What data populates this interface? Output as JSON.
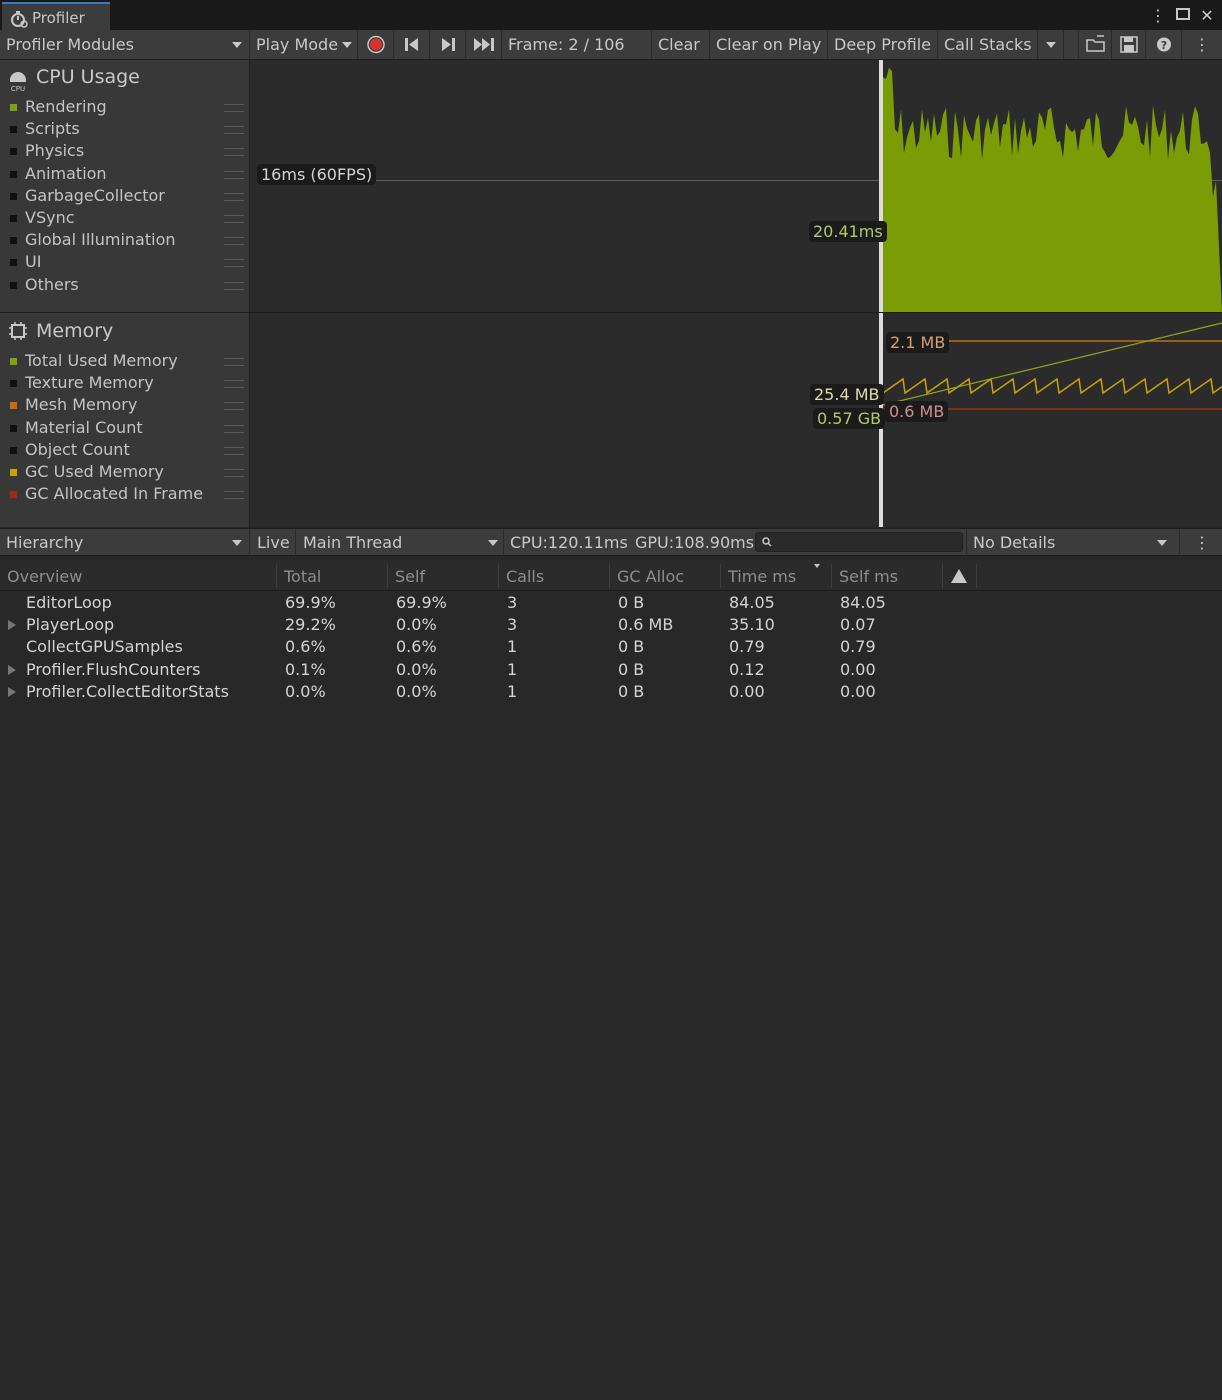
{
  "window": {
    "tab_title": "Profiler"
  },
  "toolbar": {
    "modules_label": "Profiler Modules",
    "play_mode_label": "Play Mode",
    "frame_label": "Frame: 2 / 106",
    "clear_label": "Clear",
    "clear_on_play_label": "Clear on Play",
    "deep_profile_label": "Deep Profile",
    "call_stacks_label": "Call Stacks",
    "record_color": "#d9342b"
  },
  "cpu_module": {
    "title": "CPU Usage",
    "icon_text": "CPU",
    "items": [
      {
        "label": "Rendering",
        "color": "#7ca113"
      },
      {
        "label": "Scripts",
        "color": "#111111"
      },
      {
        "label": "Physics",
        "color": "#111111"
      },
      {
        "label": "Animation",
        "color": "#111111"
      },
      {
        "label": "GarbageCollector",
        "color": "#111111"
      },
      {
        "label": "VSync",
        "color": "#111111"
      },
      {
        "label": "Global Illumination",
        "color": "#111111"
      },
      {
        "label": "UI",
        "color": "#111111"
      },
      {
        "label": "Others",
        "color": "#111111"
      }
    ],
    "fps_marker": "16ms (60FPS)",
    "selected_value": "20.41ms",
    "fill_color": "#7b9c04"
  },
  "memory_module": {
    "title": "Memory",
    "items": [
      {
        "label": "Total Used Memory",
        "color": "#7ca113"
      },
      {
        "label": "Texture Memory",
        "color": "#111111"
      },
      {
        "label": "Mesh Memory",
        "color": "#c86a14"
      },
      {
        "label": "Material Count",
        "color": "#111111"
      },
      {
        "label": "Object Count",
        "color": "#111111"
      },
      {
        "label": "GC Used Memory",
        "color": "#c9a20a"
      },
      {
        "label": "GC Allocated In Frame",
        "color": "#a12a16"
      }
    ],
    "labels": {
      "top_mb": "2.1 MB",
      "gc_used": "25.4 MB",
      "total_gb": "0.57 GB",
      "alloc_mb": "0.6 MB"
    }
  },
  "hierarchy_toolbar": {
    "view_label": "Hierarchy",
    "live_label": "Live",
    "thread_label": "Main Thread",
    "cpu_time": "CPU:120.11ms",
    "gpu_time": "GPU:108.90ms",
    "search_placeholder": "",
    "details_label": "No Details"
  },
  "table": {
    "columns": [
      "Overview",
      "Total",
      "Self",
      "Calls",
      "GC Alloc",
      "Time ms",
      "Self ms"
    ],
    "rows": [
      {
        "name": "EditorLoop",
        "expandable": false,
        "total": "69.9%",
        "self": "69.9%",
        "calls": "3",
        "gc": "0 B",
        "time": "84.05",
        "self_ms": "84.05"
      },
      {
        "name": "PlayerLoop",
        "expandable": true,
        "total": "29.2%",
        "self": "0.0%",
        "calls": "3",
        "gc": "0.6 MB",
        "time": "35.10",
        "self_ms": "0.07"
      },
      {
        "name": "CollectGPUSamples",
        "expandable": false,
        "total": "0.6%",
        "self": "0.6%",
        "calls": "1",
        "gc": "0 B",
        "time": "0.79",
        "self_ms": "0.79"
      },
      {
        "name": "Profiler.FlushCounters",
        "expandable": true,
        "total": "0.1%",
        "self": "0.0%",
        "calls": "1",
        "gc": "0 B",
        "time": "0.12",
        "self_ms": "0.00"
      },
      {
        "name": "Profiler.CollectEditorStats",
        "expandable": true,
        "total": "0.0%",
        "self": "0.0%",
        "calls": "1",
        "gc": "0 B",
        "time": "0.00",
        "self_ms": "0.00"
      }
    ]
  }
}
